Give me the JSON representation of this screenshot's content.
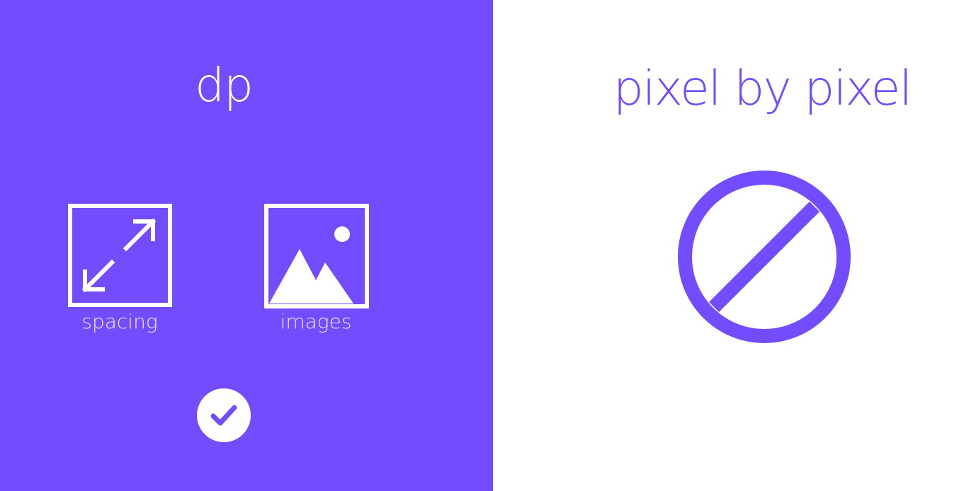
{
  "left_panel": {
    "title": "dp",
    "items": [
      {
        "label": "spacing",
        "icon": "resize-arrows-icon"
      },
      {
        "label": "images",
        "icon": "image-mountain-icon"
      }
    ],
    "status_icon": "check-circle-icon"
  },
  "right_panel": {
    "title": "pixel by pixel",
    "status_icon": "prohibited-icon"
  },
  "colors": {
    "accent": "#734cfd",
    "background": "#ffffff",
    "foreground": "#ffffff"
  }
}
